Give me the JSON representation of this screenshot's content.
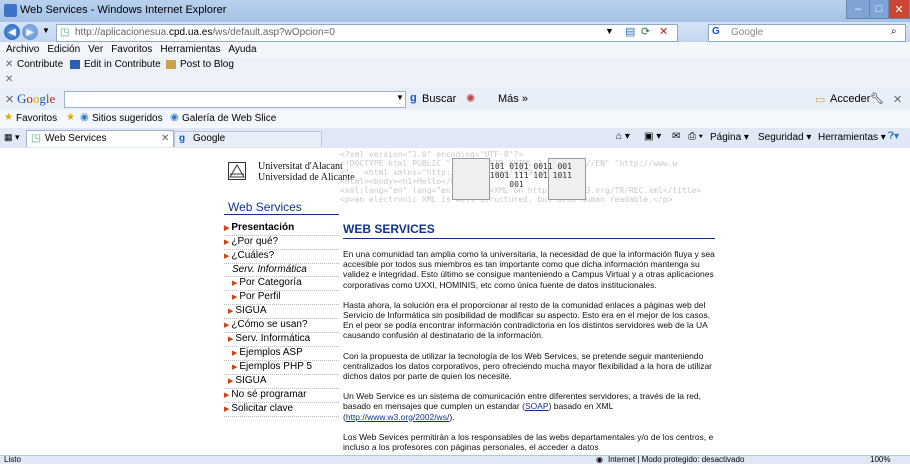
{
  "window": {
    "title": "Web Services - Windows Internet Explorer"
  },
  "address": {
    "url_prefix": "http://aplicacionesua.",
    "url_domain": "cpd.ua.es",
    "url_suffix": "/ws/default.asp?wOpcion=0"
  },
  "search": {
    "placeholder": "Google"
  },
  "menu": [
    "Archivo",
    "Edición",
    "Ver",
    "Favoritos",
    "Herramientas",
    "Ayuda"
  ],
  "contribute": {
    "contribute": "Contribute",
    "edit": "Edit in Contribute",
    "post": "Post to Blog"
  },
  "google_bar": {
    "logo": "Google",
    "buscar": "Buscar",
    "mas": "Más »",
    "acceder": "Acceder"
  },
  "favorites": {
    "favoritos": "Favoritos",
    "sitios": "Sitios sugeridos",
    "galeria": "Galería de Web Slice"
  },
  "tabs": [
    {
      "label": "Web Services"
    },
    {
      "label": "Google"
    }
  ],
  "cmdbar": {
    "pagina": "Página",
    "seguridad": "Seguridad",
    "herramientas": "Herramientas"
  },
  "site": {
    "uni_line1": "Universitat d'Alacant",
    "uni_line2": "Universidad de Alicante",
    "section_title": "Web Services",
    "banner_lines": [
      "<?xml version=\"1.0\" encoding=\"UTF-8\"?>",
      "<!DOCTYPE html PUBLIC \"-//W3C//DTD XHTML 1.0 Strict//EN\" \"http://www.w",
      "<!-- <html xmlns=\"http://www.w3.org/1999/xhtml\">",
      "<html><body><h1>Hello</h1>",
      "<xml:lang=\"en\" lang=\"en\"><title>XML on http://www.w3.org/TR/REC.xml</title>",
      "<p>an electronic XML is well structured, but also human readable.</p>"
    ],
    "binary": [
      "101",
      "0101",
      "0011",
      "001",
      "1001",
      "111",
      "101",
      "1011",
      "001"
    ],
    "nav": [
      {
        "label": "Presentación",
        "level": 1,
        "selected": true
      },
      {
        "label": "¿Por qué?",
        "level": 1
      },
      {
        "label": "¿Cuáles?",
        "level": 1
      },
      {
        "label": "Serv. Informática",
        "level": 2,
        "italic": true
      },
      {
        "label": "Por Categoría",
        "level": 2
      },
      {
        "label": "Por Perfil",
        "level": 2
      },
      {
        "label": "SIGUA",
        "level": 1
      },
      {
        "label": "¿Cómo se usan?",
        "level": 1
      },
      {
        "label": "Serv. Informática",
        "level": 1
      },
      {
        "label": "Ejemplos ASP",
        "level": 2
      },
      {
        "label": "Ejemplos PHP 5",
        "level": 2
      },
      {
        "label": "SIGUA",
        "level": 1
      },
      {
        "label": "No sé programar",
        "level": 1
      },
      {
        "label": "Solicitar clave",
        "level": 1
      }
    ],
    "heading": "WEB SERVICES",
    "p1": "En una comunidad tan amplia como la universitaria, la necesidad de que la información fluya y sea accesible por todos sus miembros es tan importante como que dicha información mantenga su validez e integridad. Esto último se consigue manteniendo a Campus Virtual y a otras aplicaciones corporativas como UXXI, HOMINIS, etc como única fuente de datos institucionales.",
    "p2": "Hasta ahora, la solución era el proporcionar al resto de la comunidad enlaces a páginas web del Servicio de Informática sin posibilidad de modificar su aspecto. Esto era en el mejor de los casos. En el peor se podía encontrar información contradictoria en los distintos servidores web de la UA causando confusión al destinatario de la información.",
    "p3": "Con la propuesta de utilizar la tecnología de los Web Services, se pretende seguir manteniendo centralizados los datos corporativos, pero ofreciendo mucha mayor flexibilidad a la hora de utilizar dichos datos por parte de quien los necesite.",
    "p4_a": "Un Web Service es un sistema de comunicación entre diferentes servidores, a través de la red, basado en mensajes que cumplen un estandar (",
    "p4_soap": "SOAP",
    "p4_b": ") basado en XML (",
    "p4_link": "http://www.w3.org/2002/ws/",
    "p4_c": ").",
    "p5": "Los Web Sevices permitirán a los responsables de las webs departamentales y/o de los centros, e incluso a los profesores con páginas personales, el acceder a datos"
  },
  "status": {
    "left": "Listo",
    "mode": "Internet | Modo protegido: desactivado",
    "zoom": "100%"
  }
}
